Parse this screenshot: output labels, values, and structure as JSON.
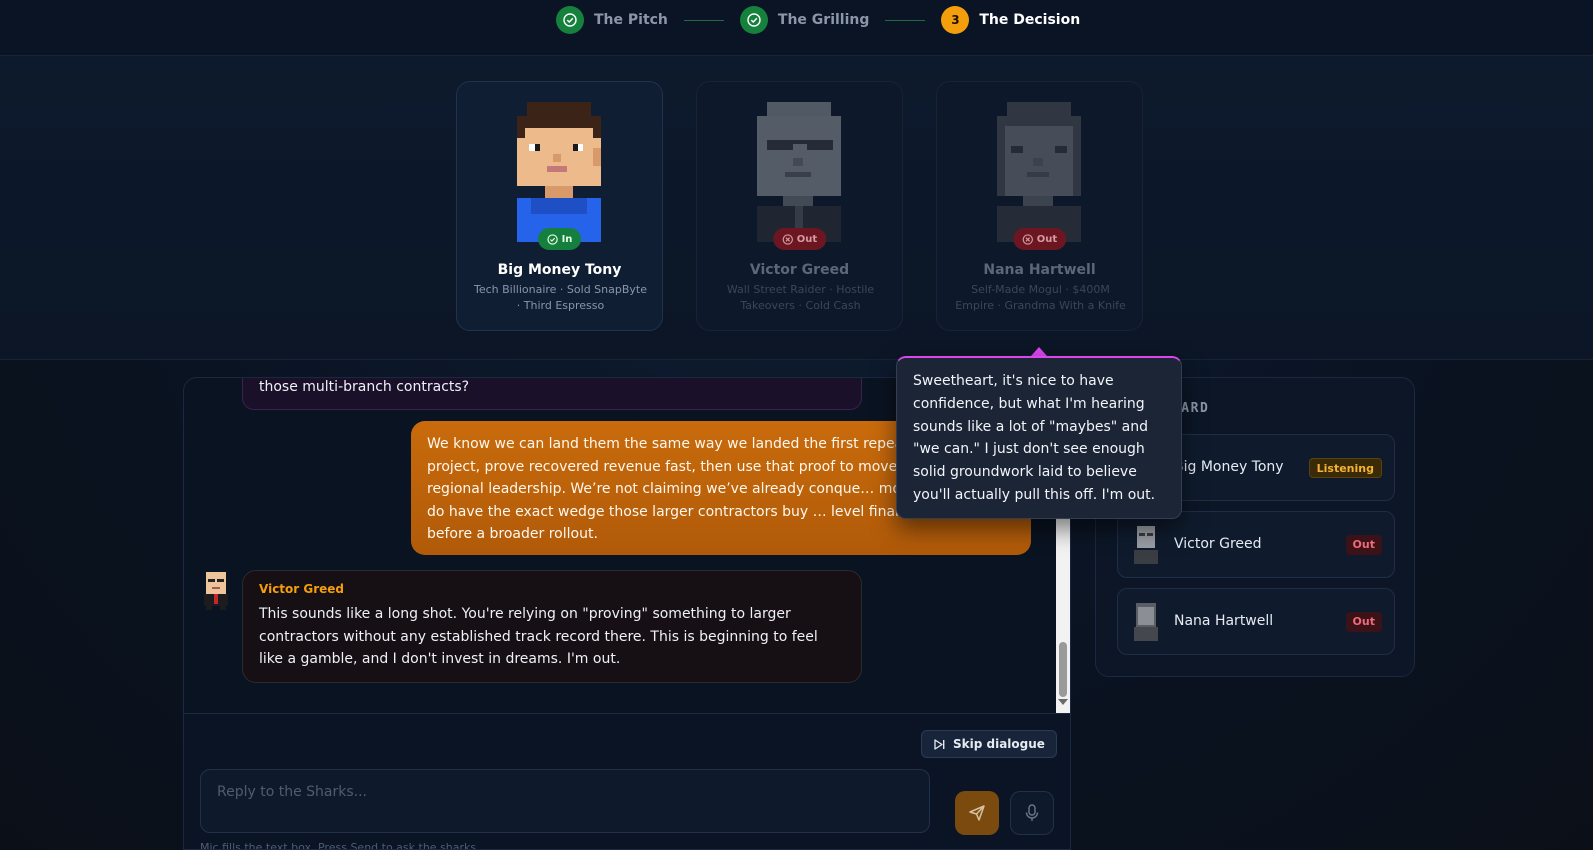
{
  "stepper": {
    "steps": [
      {
        "label": "The Pitch",
        "state": "done"
      },
      {
        "label": "The Grilling",
        "state": "done"
      },
      {
        "label": "The Decision",
        "state": "active",
        "number": "3"
      }
    ]
  },
  "sharks": [
    {
      "name": "Big Money Tony",
      "subtitle": "Tech Billionaire · Sold SnapByte · Third Espresso",
      "status": "In"
    },
    {
      "name": "Victor Greed",
      "subtitle": "Wall Street Raider · Hostile Takeovers · Cold Cash",
      "status": "Out"
    },
    {
      "name": "Nana Hartwell",
      "subtitle": "Self-Made Mogul · $400M Empire · Grandma With a Knife",
      "status": "Out"
    }
  ],
  "chat": {
    "partial_message": "those multi-branch contracts?",
    "user_message": "We know we can land them the same way we landed the first repeat acc… active project, prove recovered revenue fast, then use that proof to move… branch and regional leadership. We’re not claiming we’ve already conque… mountain, but we do have the exact wedge those larger contractors buy … level financial proof before a broader rollout.",
    "shark_message": {
      "speaker": "Victor Greed",
      "text": "This sounds like a long shot. You're relying on \"proving\" something to larger contractors without any established track record there. This is beginning to feel like a gamble, and I don't invest in dreams. I'm out."
    },
    "skip_label": "Skip dialogue",
    "input_placeholder": "Reply to the Sharks...",
    "hint": "Mic fills the text box. Press Send to ask the sharks."
  },
  "scoreboard": {
    "title": "SCOREBOARD",
    "rows": [
      {
        "name": "Big Money Tony",
        "status": "Listening"
      },
      {
        "name": "Victor Greed",
        "status": "Out"
      },
      {
        "name": "Nana Hartwell",
        "status": "Out"
      }
    ]
  },
  "tooltip": {
    "text": "Sweetheart, it's nice to have confidence, but what I'm hearing sounds like a lot of \"maybes\" and \"we can.\" I just don't see enough solid groundwork laid to believe you'll actually pull this off. I'm out."
  },
  "colors": {
    "accent": "#f59e0b",
    "success": "#15803d",
    "danger": "#f06a78",
    "tooltip_border": "#d946ef"
  }
}
